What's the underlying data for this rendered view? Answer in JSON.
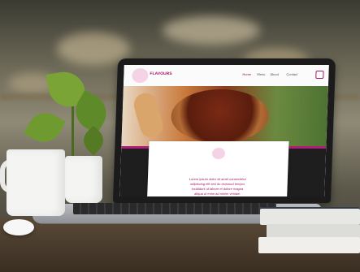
{
  "website": {
    "brand": "FLAVOURS",
    "nav": [
      "Home",
      "Menu",
      "About",
      "Contact"
    ],
    "card_lines": [
      "Lorem ipsum dolor sit amet consectetur",
      "adipiscing elit sed do eiusmod tempor",
      "incididunt ut labore et dolore magna",
      "aliqua ut enim ad minim veniam"
    ]
  }
}
